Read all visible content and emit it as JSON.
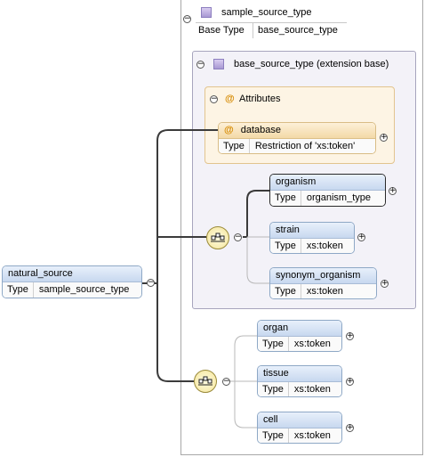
{
  "root": {
    "name": "natural_source",
    "type_key": "Type",
    "type_value": "sample_source_type"
  },
  "complex_type": {
    "name": "sample_source_type",
    "base_key": "Base Type",
    "base_value": "base_source_type"
  },
  "extension": {
    "title": "base_source_type (extension base)"
  },
  "attributes": {
    "title": "Attributes",
    "symbol": "@",
    "items": [
      {
        "name": "database",
        "type_key": "Type",
        "type_value": "Restriction of 'xs:token'"
      }
    ]
  },
  "sequence1": [
    {
      "name": "organism",
      "type_key": "Type",
      "type_value": "organism_type"
    },
    {
      "name": "strain",
      "type_key": "Type",
      "type_value": "xs:token"
    },
    {
      "name": "synonym_organism",
      "type_key": "Type",
      "type_value": "xs:token"
    }
  ],
  "sequence2": [
    {
      "name": "organ",
      "type_key": "Type",
      "type_value": "xs:token"
    },
    {
      "name": "tissue",
      "type_key": "Type",
      "type_value": "xs:token"
    },
    {
      "name": "cell",
      "type_key": "Type",
      "type_value": "xs:token"
    }
  ],
  "colors": {
    "node_header": "#c7d8ef",
    "attribute_header": "#f3d9a7",
    "extension_bg": "#f3f2f8",
    "compositor": "#f4e59a"
  },
  "icons": {
    "expand": "plus-circle-icon",
    "collapse": "minus-circle-icon",
    "sequence": "sequence-compositor-icon",
    "complex_type": "complex-type-icon"
  }
}
